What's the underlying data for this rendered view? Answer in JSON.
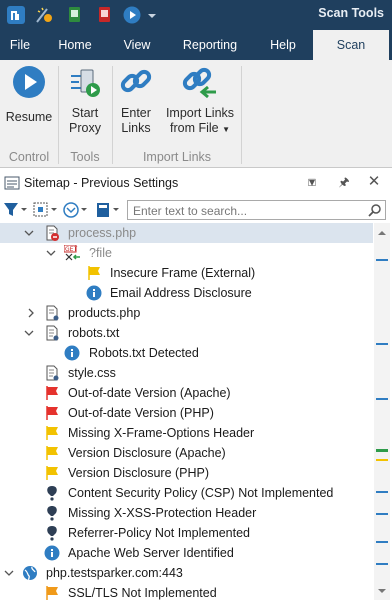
{
  "app": {
    "title": "Scan Tools"
  },
  "tabs": [
    {
      "label": "File"
    },
    {
      "label": "Home"
    },
    {
      "label": "View"
    },
    {
      "label": "Reporting"
    },
    {
      "label": "Help"
    },
    {
      "label": "Scan",
      "active": true
    }
  ],
  "ribbon": {
    "buttons": {
      "resume": "Resume",
      "start_proxy_1": "Start",
      "start_proxy_2": "Proxy",
      "enter_links_1": "Enter",
      "enter_links_2": "Links",
      "import_links_1": "Import Links",
      "import_links_2": "from File"
    },
    "groups": {
      "control": "Control",
      "tools": "Tools",
      "import_links": "Import Links"
    }
  },
  "panel": {
    "title": "Sitemap - Previous Settings",
    "search_placeholder": "Enter text to search..."
  },
  "tree": [
    {
      "label": "process.php",
      "icon": "php-file-error-icon",
      "expanded": true,
      "grey": true
    },
    {
      "label": "?file",
      "icon": "get-parameter-icon",
      "expanded": true,
      "grey": true
    },
    {
      "label": "Insecure Frame (External)",
      "icon": "yellow-flag-icon"
    },
    {
      "label": "Email Address Disclosure",
      "icon": "info-icon"
    },
    {
      "label": "products.php",
      "icon": "php-file-icon",
      "expanded": false
    },
    {
      "label": "robots.txt",
      "icon": "txt-file-icon",
      "expanded": true
    },
    {
      "label": "Robots.txt Detected",
      "icon": "info-icon"
    },
    {
      "label": "style.css",
      "icon": "css-file-icon"
    },
    {
      "label": "Out-of-date Version (Apache)",
      "icon": "red-flag-icon"
    },
    {
      "label": "Out-of-date Version (PHP)",
      "icon": "red-flag-icon"
    },
    {
      "label": "Missing X-Frame-Options Header",
      "icon": "yellow-flag-icon"
    },
    {
      "label": "Version Disclosure (Apache)",
      "icon": "yellow-flag-icon"
    },
    {
      "label": "Version Disclosure (PHP)",
      "icon": "yellow-flag-icon"
    },
    {
      "label": "Content Security Policy (CSP) Not Implemented",
      "icon": "best-practice-icon"
    },
    {
      "label": "Missing X-XSS-Protection Header",
      "icon": "best-practice-icon"
    },
    {
      "label": "Referrer-Policy Not Implemented",
      "icon": "best-practice-icon"
    },
    {
      "label": "Apache Web Server Identified",
      "icon": "info-icon"
    },
    {
      "label": "php.testsparker.com:443",
      "icon": "globe-icon",
      "expanded": true
    },
    {
      "label": "SSL/TLS Not Implemented",
      "icon": "orange-flag-icon"
    }
  ],
  "colors": {
    "titlebar": "#1f3f5e",
    "accent_blue": "#2f7dc2",
    "red_flag": "#e5322d",
    "yellow_flag": "#f2c200",
    "orange_flag": "#f09a1a",
    "best_practice": "#2e3f55",
    "info": "#2f7dc2"
  }
}
